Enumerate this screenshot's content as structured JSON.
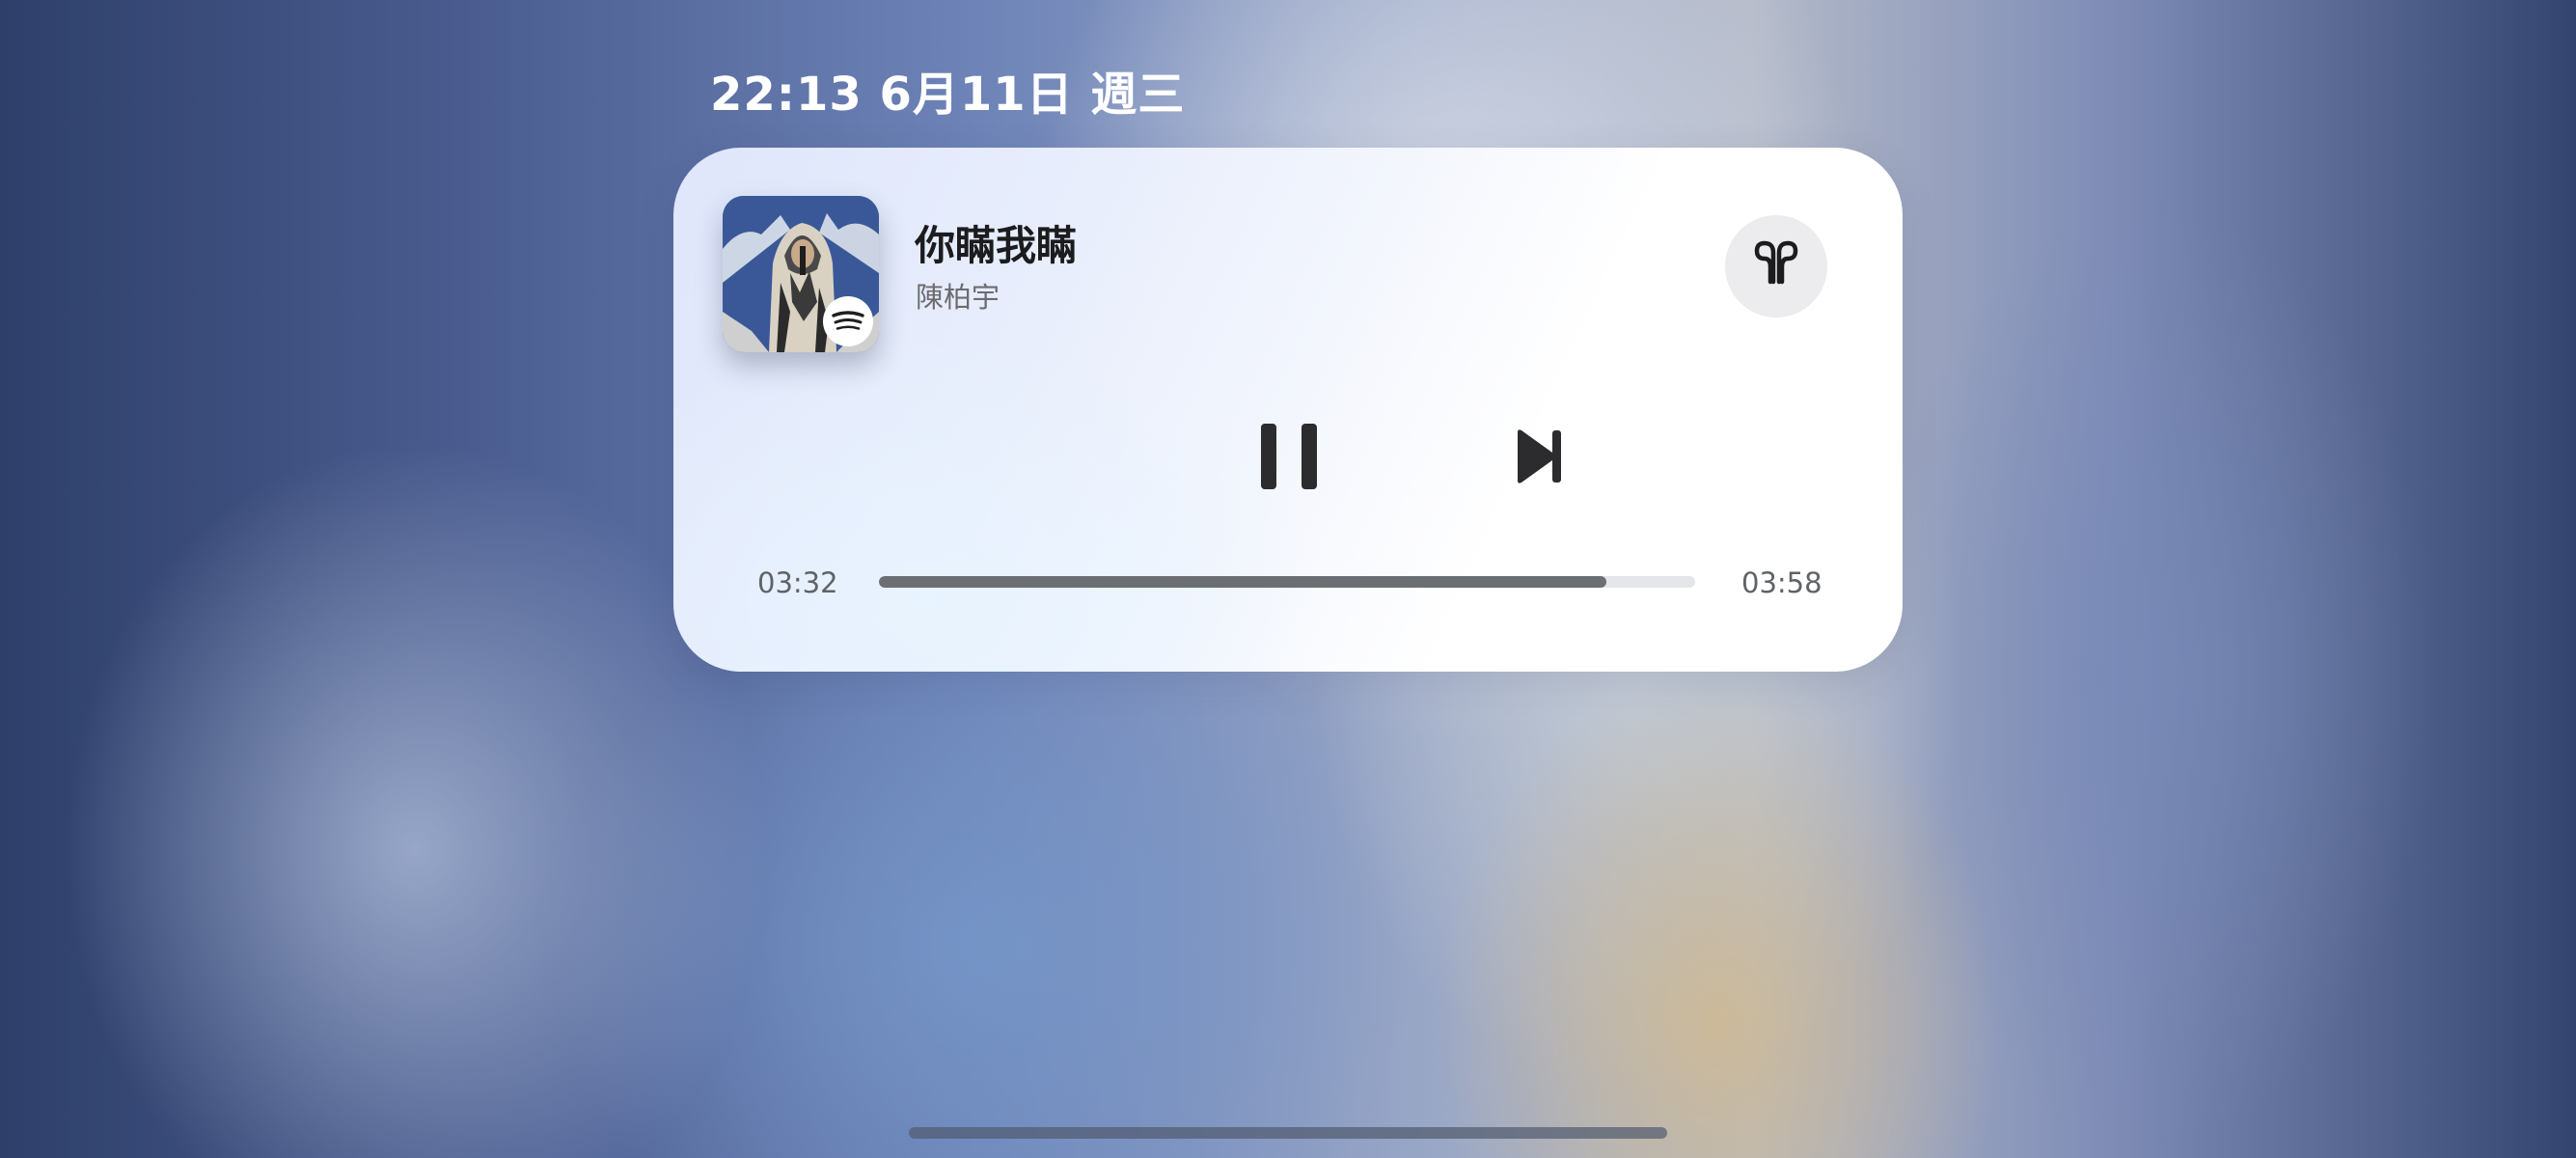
{
  "status": {
    "datetime": "22:13 6月11日 週三"
  },
  "now_playing": {
    "title": "你瞞我瞞",
    "artist": "陳柏宇",
    "elapsed": "03:32",
    "duration": "03:58",
    "progress_fraction": 0.891,
    "output_device_icon": "airpods-icon",
    "source_badge_icon": "spotify-icon"
  },
  "controls": {
    "play_state": "playing",
    "pause_icon": "pause-icon",
    "next_icon": "next-track-icon"
  },
  "colors": {
    "progress_fill": "#6b6e73",
    "progress_track": "#e4e6ea",
    "title": "#1c1c1e",
    "secondary_text": "#6c6c70"
  }
}
